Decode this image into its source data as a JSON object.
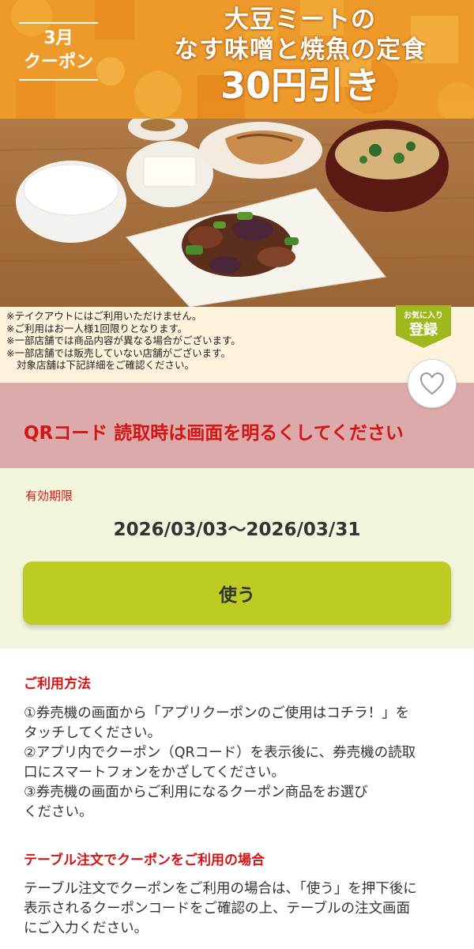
{
  "banner": {
    "badge_month": "3月",
    "badge_kind": "クーポン",
    "title_line1": "大豆ミートの",
    "title_line2": "なす味噌と焼魚の定食",
    "title_line3": "30円引き"
  },
  "photo": {
    "alt": "定食の写真"
  },
  "notes": [
    "※テイクアウトにはご利用いただけません。",
    "※ご利用はお一人様1回限りとなります。",
    "※一部店舗では商品内容が異なる場合がございます。",
    "※一部店舗では販売していない店舗がございます。",
    "対象店舗は下記詳細をご確認ください。"
  ],
  "favorite_tag": {
    "small": "お気に入り",
    "big": "登録"
  },
  "qr_notice": "QRコード 読取時は画面を明るくしてください",
  "validity": {
    "label": "有効期限",
    "dates": "2026/03/03～2026/03/31"
  },
  "use_button": "使う",
  "howto": {
    "title": "ご利用方法",
    "lines": [
      "①券売機の画面から「アプリクーポンのご使用はコチラ！」を",
      "タッチしてください。",
      "②アプリ内でクーポン（QRコード）を表示後に、券売機の読取",
      "口にスマートフォンをかざしてください。",
      "③券売機の画面からご利用になるクーポン商品をお選び",
      "ください。"
    ]
  },
  "table_order": {
    "title": "テーブル注文でクーポンをご利用の場合",
    "lines": [
      "テーブル注文でクーポンをご利用の場合は、「使う」を押下後に",
      "表示されるクーポンコードをご確認の上、テーブルの注文画面",
      "にご入力ください。"
    ]
  },
  "colors": {
    "banner_orange": "#ee9a2a",
    "notice_red": "#d41515",
    "notice_band": "#dcaaab",
    "validity_bg": "#f2f6dc",
    "use_button": "#bccc22",
    "notes_bg": "#fdf2dc",
    "favorite_green": "#9fb81e"
  }
}
